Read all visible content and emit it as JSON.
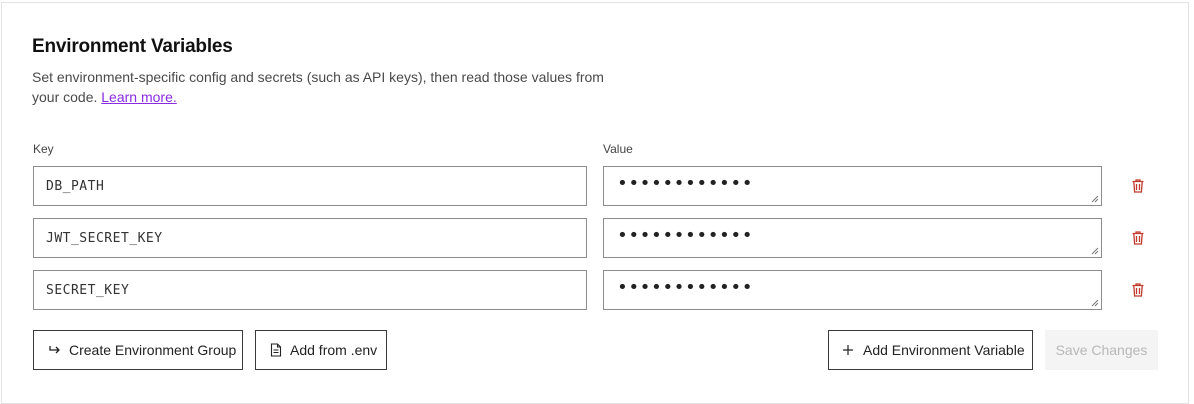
{
  "section": {
    "title": "Environment Variables",
    "description_before": "Set environment-specific config and secrets (such as API keys), then read those values from your code. ",
    "learn_more": "Learn more."
  },
  "columns": {
    "key": "Key",
    "value": "Value"
  },
  "variables": [
    {
      "key": "DB_PATH",
      "value_masked": "••••••••••••"
    },
    {
      "key": "JWT_SECRET_KEY",
      "value_masked": "••••••••••••"
    },
    {
      "key": "SECRET_KEY",
      "value_masked": "••••••••••••"
    }
  ],
  "actions": {
    "create_group": "Create Environment Group",
    "add_from_env": "Add from .env",
    "add_variable": "Add Environment Variable",
    "save_changes": "Save Changes"
  },
  "colors": {
    "accent_link": "#8a2be2",
    "delete": "#c0392b",
    "disabled_bg": "#f4f4f4"
  },
  "icons": {
    "create_group": "arrow-return-icon",
    "add_from_env": "file-icon",
    "add_variable": "plus-icon",
    "delete": "trash-icon"
  }
}
